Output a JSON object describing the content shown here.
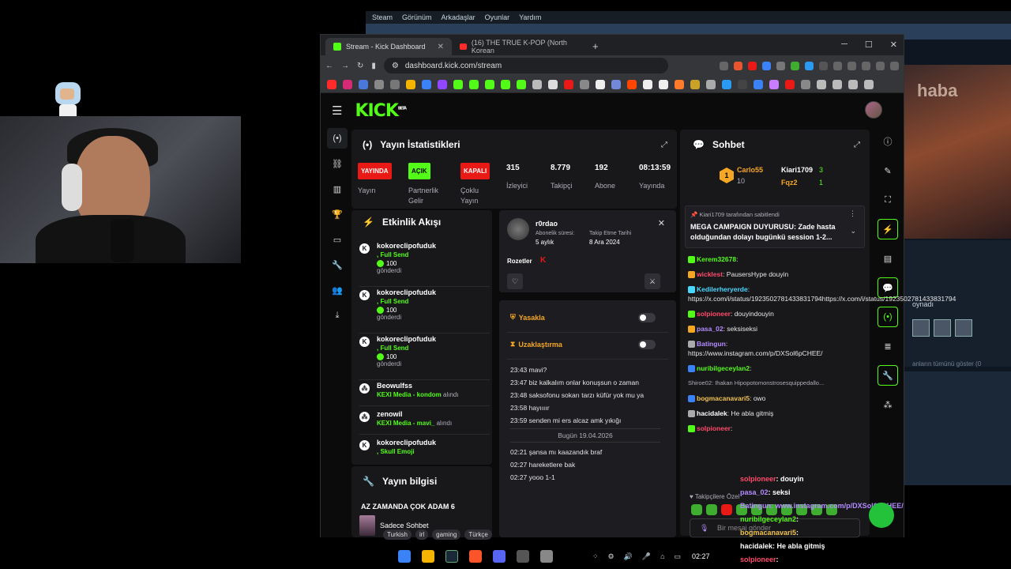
{
  "steam": {
    "menu": [
      "Steam",
      "Görünüm",
      "Arkadaşlar",
      "Oyunlar",
      "Yardım"
    ],
    "side_text": "oynadı",
    "hint": "anların tümünü göster (0",
    "art_text": "haba"
  },
  "browser": {
    "tabs": [
      {
        "title": "Stream - Kick Dashboard"
      },
      {
        "title": "(16) THE TRUE K-POP (North Korean"
      }
    ],
    "url": "dashboard.kick.com/stream"
  },
  "kick": {
    "logo": "KICK",
    "stats": {
      "title": "Yayın İstatistikleri",
      "items": [
        {
          "badge": "YAYINDA",
          "label": "Yayın",
          "style": "red"
        },
        {
          "badge": "AÇIK",
          "label": "Partnerlik Gelir",
          "style": "green"
        },
        {
          "badge": "KAPALI",
          "label": "Çoklu Yayın",
          "style": "red"
        },
        {
          "value": "315",
          "label": "İzleyici"
        },
        {
          "value": "8.779",
          "label": "Takipçi"
        },
        {
          "value": "192",
          "label": "Abone"
        },
        {
          "value": "08:13:59",
          "label": "Yayında"
        }
      ]
    },
    "activity": {
      "title": "Etkinlik Akışı",
      "items": [
        {
          "name": "kokoreclipofuduk",
          "action": ", Full Send",
          "amount": "100",
          "note": "gönderdi"
        },
        {
          "name": "kokoreclipofuduk",
          "action": ", Full Send",
          "amount": "100",
          "note": "gönderdi"
        },
        {
          "name": "kokoreclipofuduk",
          "action": ", Full Send",
          "amount": "100",
          "note": "gönderdi"
        },
        {
          "name": "Beowulfss",
          "action": "KEXI Media - kondom",
          "suffix": "alındı"
        },
        {
          "name": "zenowil",
          "action": "KEXI Media - mavi_",
          "suffix": "alındı"
        },
        {
          "name": "kokoreclipofuduk",
          "action": ", Skull Emoji"
        }
      ]
    },
    "stream_info": {
      "title": "Yayın bilgisi",
      "stream_title": "AZ ZAMANDA ÇOK ADAM 6",
      "category": "Sadece Sohbet",
      "tags": [
        "Turkish",
        "irl",
        "gaming",
        "Türkçe"
      ]
    },
    "user_card": {
      "username": "r0rdao",
      "sub_label": "Abonelik süresi:",
      "sub_value": "5 aylık",
      "follow_label": "Takip Etme Tarihi",
      "follow_value": "8 Ara 2024",
      "badges_label": "Rozetler"
    },
    "moderation": {
      "ban_label": "Yasakla",
      "timeout_label": "Uzaklaştırma",
      "log": [
        "23:43 mavi?",
        "23:47 biz kalkalım onlar konuşsun o zaman",
        "23:48 saksofonu sokarı tarzı küfür yok mu ya",
        "23:58 hayıııır",
        "23:59 senden mi ers alcaz amk yıkığı"
      ],
      "date_divider": "Bugün 19.04.2026",
      "log2": [
        "02:21 şansa mı kaazandık braf",
        "02:27 hareketlere bak",
        "02:27 yooo 1-1"
      ]
    },
    "chat": {
      "title": "Sohbet",
      "leader1": "Carlo55",
      "leader1_score": "10",
      "leader2": "Kiari1709",
      "leader2_score": "3",
      "leader3": "Fqz2",
      "leader3_score": "1",
      "pinned_by": "Kiari1709 tarafından sabitlendi",
      "pinned_user": "Kiari1709",
      "pinned_text": "MEGA CAMPAIGN DUYURUSU: Zade hasta olduğundan dolayı bugünkü session 1-2...",
      "messages": [
        {
          "user": "Kerem32678",
          "text": ":",
          "color": "#53fc18"
        },
        {
          "user": "wicklest",
          "text": ": PausersHype douyin",
          "color": "#ff4a6a"
        },
        {
          "user": "Kedilerheryerde",
          "text": ": https://x.com/i/status/1923502781433831794https://x.com/i/status/1923502781433831794",
          "color": "#4ad7ff"
        },
        {
          "user": "solpioneer",
          "text": ": douyindouyin",
          "color": "#ff4a6a"
        },
        {
          "user": "pasa_02",
          "text": ": seksiseksi",
          "color": "#b48cff"
        },
        {
          "user": "Batingun",
          "text": ": https://www.instagram.com/p/DXSol6pCHEE/",
          "color": "#b48cff"
        },
        {
          "user": "nuribilgeceylan2",
          "text": ":",
          "color": "#53fc18"
        },
        {
          "user": "Shiroe02",
          "text": ": Ihakan Hipopotomonstrosesquippedallo...",
          "color": "#adadb8"
        },
        {
          "user": "bogmacanavari5",
          "text": ": owo",
          "color": "#f0c24c"
        },
        {
          "user": "hacidalek",
          "text": ": He abla gitmiş",
          "color": "#fff"
        },
        {
          "user": "solpioneer",
          "text": ":",
          "color": "#ff4a6a"
        }
      ],
      "followers_only": "Takipçilere Özel",
      "input_placeholder": "Bir mesaj gönder"
    }
  },
  "overlay_chat": [
    {
      "user": "solpioneer",
      "text": ": douyin"
    },
    {
      "user": "pasa_02",
      "text": ": seksi"
    },
    {
      "user": "Batingun",
      "text": ": www.instagram.com/p/DXSol6pCHEE/"
    },
    {
      "user": "nuribilgeceylan2",
      "text": ":"
    },
    {
      "user": "bogmacanavari5",
      "text": ":"
    },
    {
      "user": "hacidalek",
      "text": ": He abla gitmiş"
    },
    {
      "user": "solpioneer",
      "text": ":"
    }
  ],
  "taskbar": {
    "time": "02:27"
  },
  "colors": {
    "kick_green": "#53fc18",
    "live_red": "#e91916",
    "panel": "#18181b"
  }
}
